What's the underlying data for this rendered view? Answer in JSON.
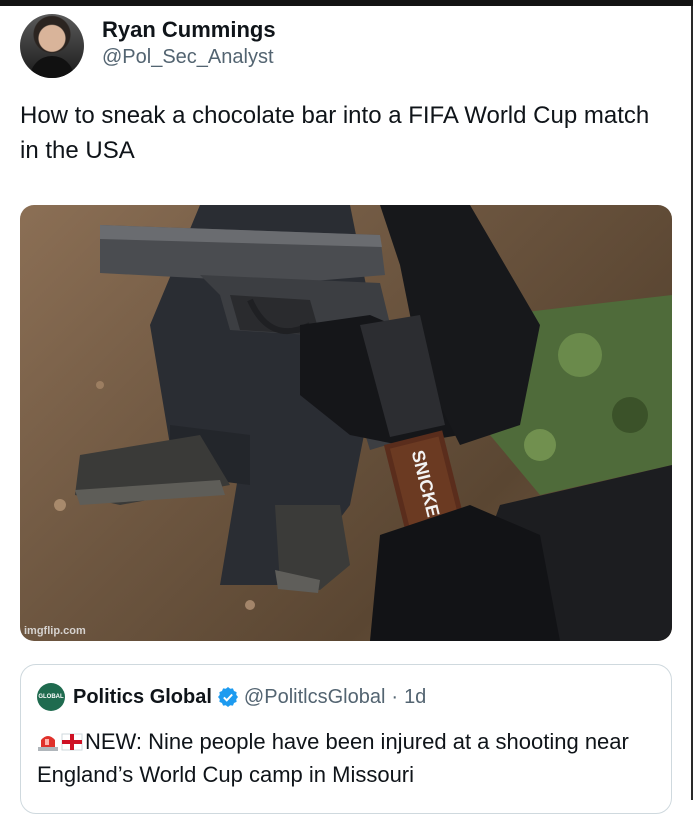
{
  "tweet": {
    "display_name": "Ryan Cummings",
    "handle": "@Pol_Sec_Analyst",
    "text": "How to sneak a chocolate bar into a FIFA World Cup match in the USA"
  },
  "media": {
    "watermark": "imgflip.com",
    "candy_label": "SNICKERS"
  },
  "quoted_tweet": {
    "avatar_text": "GLOBAL",
    "display_name": "Politics Global",
    "handle": "@PolitlcsGlobal",
    "separator": "·",
    "time": "1d",
    "emojis": [
      "rotating-light-icon",
      "england-flag-icon"
    ],
    "text": "NEW: Nine people have been injured at a shooting near England’s World Cup camp in Missouri"
  },
  "colors": {
    "primary_text": "#0f1419",
    "secondary_text": "#536471",
    "verified_blue": "#1d9bf0",
    "border": "#cfd9de"
  }
}
